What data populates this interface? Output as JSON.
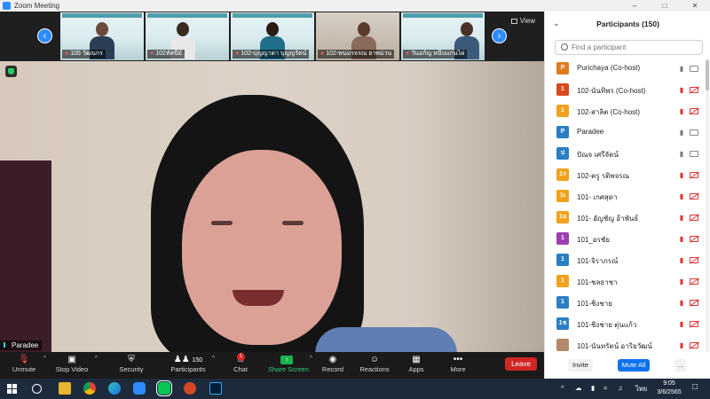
{
  "window": {
    "title": "Zoom Meeting",
    "controls": [
      "–",
      "□",
      "✕"
    ]
  },
  "filmstrip": {
    "view_label": "View",
    "thumbnails": [
      {
        "name": "105 วัฒนกร"
      },
      {
        "name": "102ทัศนีย์"
      },
      {
        "name": "102-บุญญาดา บุญญรัตน์"
      },
      {
        "name": "102-พนมรจรณ ยาพม่วน"
      },
      {
        "name": "วันอกัญ หนีบแก่นไผ่"
      }
    ]
  },
  "main_video": {
    "speaker_name": "Paradee"
  },
  "toolbar": {
    "unmute": "Unmute",
    "stop_video": "Stop Video",
    "security": "Security",
    "participants": "Participants",
    "participants_count": "150",
    "chat": "Chat",
    "chat_badge": "1",
    "share_screen": "Share Screen",
    "record": "Record",
    "reactions": "Reactions",
    "apps": "Apps",
    "more": "More",
    "leave": "Leave"
  },
  "participants_panel": {
    "title": "Participants (150)",
    "search_placeholder": "Find a participant",
    "participants": [
      {
        "initial": "P",
        "color": "#e07b1f",
        "name": "Purichaya (Co-host)",
        "mic": "on",
        "cam": "on"
      },
      {
        "initial": "1",
        "color": "#d9481f",
        "name": "102-นันทิพร (Co-host)",
        "mic": "off",
        "cam": "off"
      },
      {
        "initial": "1",
        "color": "#f0a21b",
        "name": "102-สาลิต (Co-host)",
        "mic": "off",
        "cam": "off"
      },
      {
        "initial": "P",
        "color": "#2a7fc4",
        "name": "Paradee",
        "mic": "on",
        "cam": "on"
      },
      {
        "initial": "ป",
        "color": "#2a7fc4",
        "name": "ปัณจ เศรีจัดน์",
        "mic": "on",
        "cam": "on"
      },
      {
        "initial": "1ร",
        "color": "#f0a21b",
        "name": "102-ครู รติพจรณ",
        "mic": "off",
        "cam": "off"
      },
      {
        "initial": "1เ",
        "color": "#f0a21b",
        "name": "101- เกศสุดา",
        "mic": "off",
        "cam": "off"
      },
      {
        "initial": "1อ",
        "color": "#f0a21b",
        "name": "101- อัญชัญ อ้าพันธ์",
        "mic": "off",
        "cam": "off"
      },
      {
        "initial": "1",
        "color": "#9b3fb0",
        "name": "101_อรชัย",
        "mic": "off",
        "cam": "off"
      },
      {
        "initial": "1",
        "color": "#2a7fc4",
        "name": "101-จิราภรณ์",
        "mic": "off",
        "cam": "off"
      },
      {
        "initial": "1",
        "color": "#f0a21b",
        "name": "101-ชลธาชา",
        "mic": "off",
        "cam": "off"
      },
      {
        "initial": "1",
        "color": "#2a7fc4",
        "name": "101-ชิงชาย",
        "mic": "off",
        "cam": "off"
      },
      {
        "initial": "1ช",
        "color": "#2a7fc4",
        "name": "101-ชิงชาย ตุ่นแก้ว",
        "mic": "off",
        "cam": "off"
      },
      {
        "initial": "",
        "color": "#b08a6a",
        "name": "101-นันทรัตน์ อาริยวัฒน์",
        "mic": "off",
        "cam": "off"
      }
    ],
    "invite": "Invite",
    "mute_all": "Mute All",
    "more": "..."
  },
  "taskbar": {
    "language": "ไทย",
    "time": "9:05",
    "date": "3/6/2565"
  }
}
